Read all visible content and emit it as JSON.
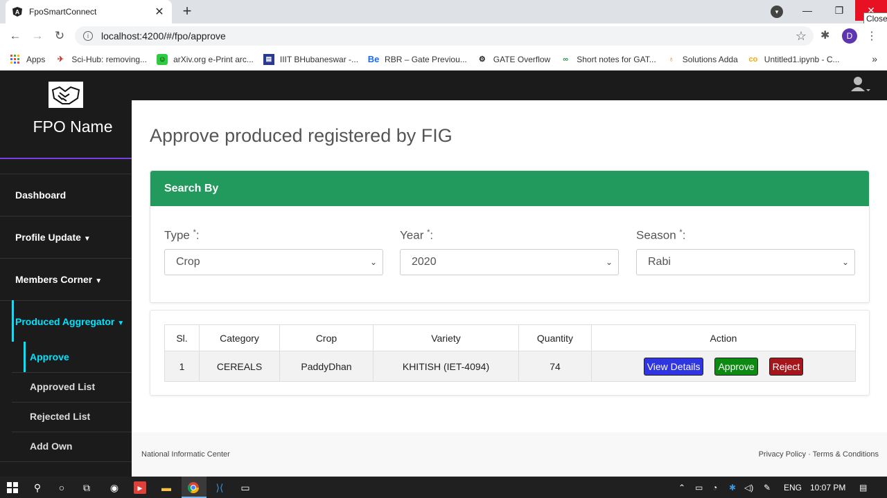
{
  "browser": {
    "tab_title": "FpoSmartConnect",
    "url": "localhost:4200/#/fpo/approve",
    "close_tooltip": "Close",
    "profile_initial": "D",
    "bookmarks": [
      {
        "label": "Apps"
      },
      {
        "label": "Sci-Hub: removing..."
      },
      {
        "label": "arXiv.org e-Print arc..."
      },
      {
        "label": "IIIT BHubaneswar -..."
      },
      {
        "label": "RBR – Gate Previou..."
      },
      {
        "label": "GATE Overflow"
      },
      {
        "label": "Short notes for GAT..."
      },
      {
        "label": "Solutions Adda"
      },
      {
        "label": "Untitled1.ipynb - C..."
      }
    ]
  },
  "sidebar": {
    "fpo_name": "FPO Name",
    "items": [
      {
        "label": "Dashboard"
      },
      {
        "label": "Profile Update"
      },
      {
        "label": "Members Corner"
      },
      {
        "label": "Produced Aggregator"
      }
    ],
    "subitems": [
      {
        "label": "Approve"
      },
      {
        "label": "Approved List"
      },
      {
        "label": "Rejected List"
      },
      {
        "label": "Add Own"
      }
    ]
  },
  "main": {
    "title": "Approve produced registered by FIG",
    "search_heading": "Search By",
    "fields": [
      {
        "label": "Type",
        "value": "Crop"
      },
      {
        "label": "Year",
        "value": "2020"
      },
      {
        "label": "Season",
        "value": "Rabi"
      }
    ],
    "required_mark": "*",
    "colon": ":",
    "table": {
      "headers": [
        "Sl.",
        "Category",
        "Crop",
        "Variety",
        "Quantity",
        "Action"
      ],
      "rows": [
        {
          "sl": "1",
          "category": "CEREALS",
          "crop": "PaddyDhan",
          "variety": "KHITISH (IET-4094)",
          "quantity": "74"
        }
      ],
      "actions": {
        "view": "View Details",
        "approve": "Approve",
        "reject": "Reject"
      }
    }
  },
  "footer": {
    "left": "National Informatic Center",
    "right": "Privacy Policy · Terms & Conditions"
  },
  "taskbar": {
    "language": "ENG",
    "time": "10:07 PM"
  },
  "colors": {
    "sidebar_bg": "#1b1b1b",
    "accent_cyan": "#00e5ff",
    "search_header": "#22995d",
    "btn_view": "#2f35e0",
    "btn_approve": "#0c8a12",
    "btn_reject": "#a5161c"
  }
}
